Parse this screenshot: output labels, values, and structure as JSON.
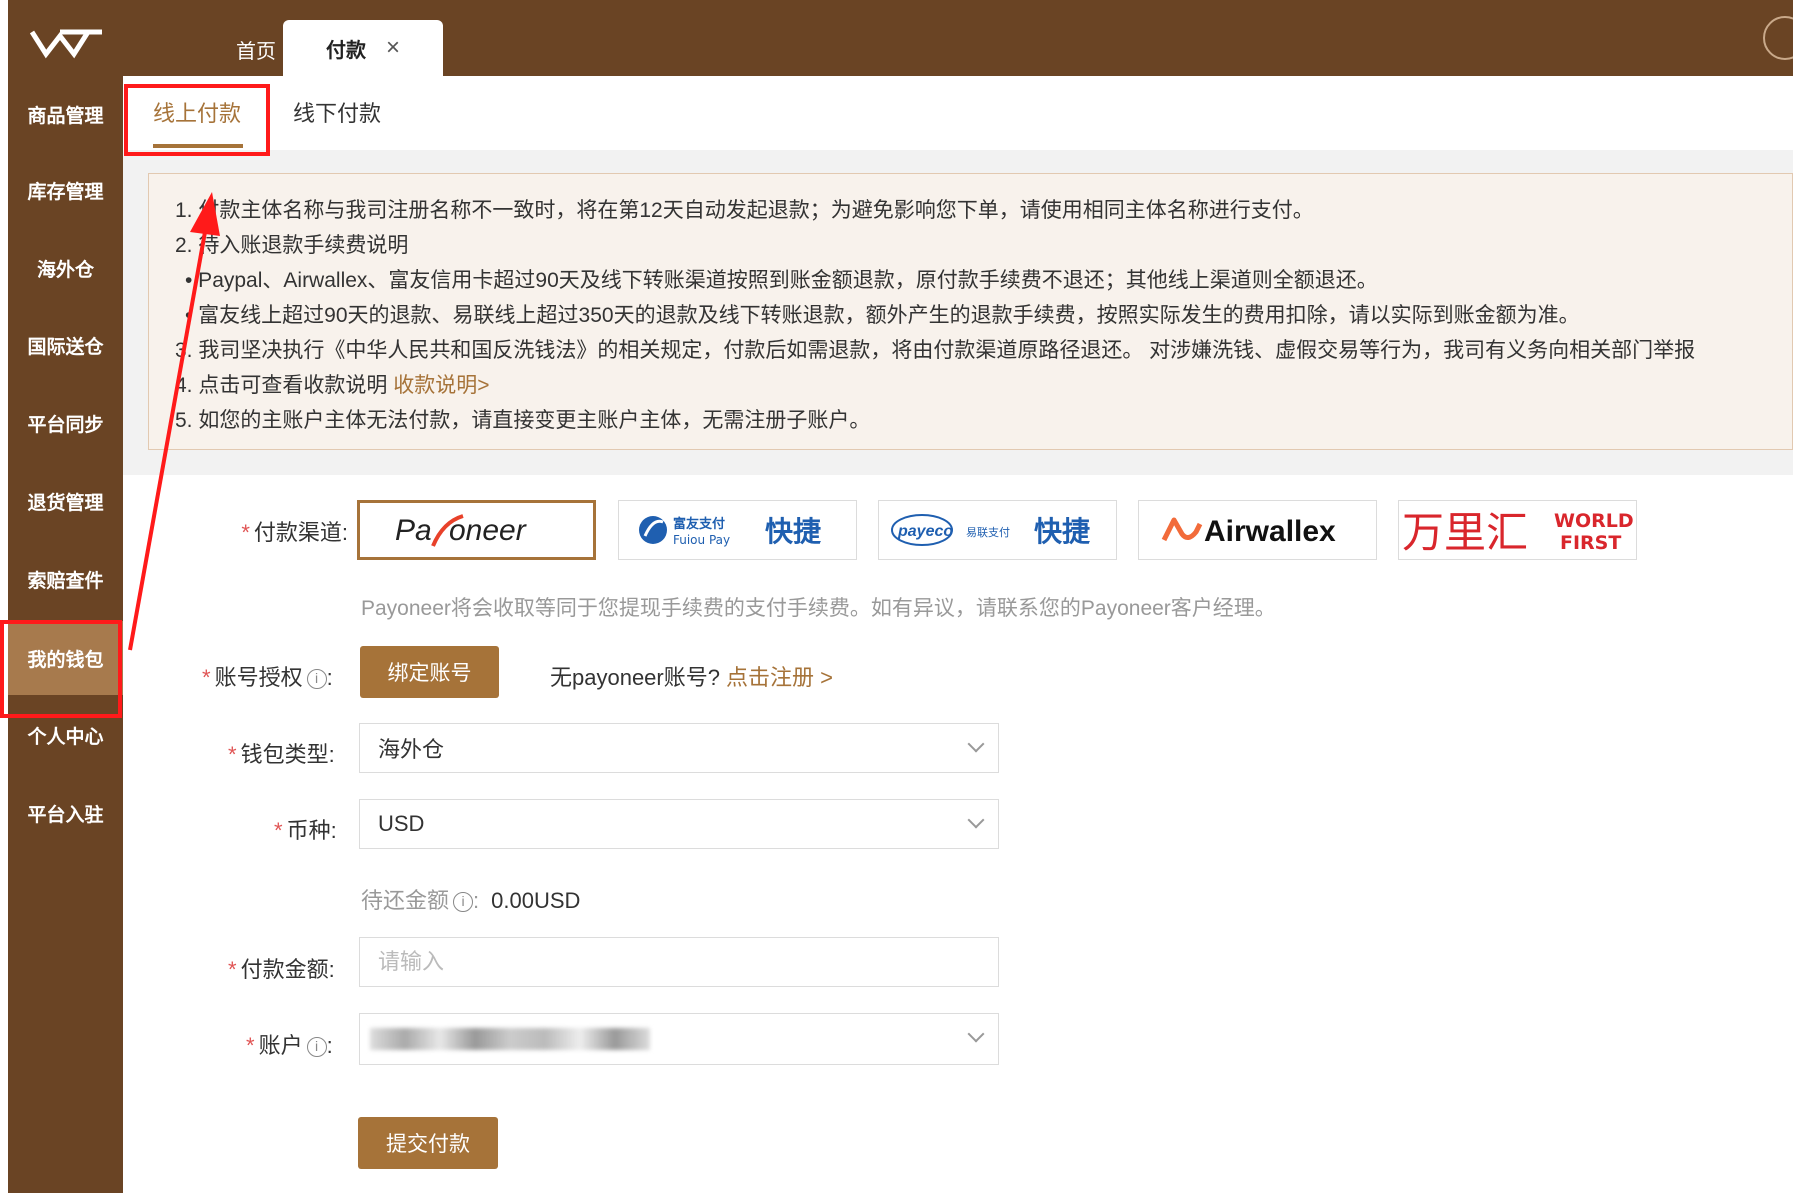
{
  "header": {
    "tab_home": "首页",
    "tab_pay": "付款",
    "tab_close": "×"
  },
  "sidebar": {
    "items": [
      {
        "label": "商品管理"
      },
      {
        "label": "库存管理"
      },
      {
        "label": "海外仓"
      },
      {
        "label": "国际送仓"
      },
      {
        "label": "平台同步"
      },
      {
        "label": "退货管理"
      },
      {
        "label": "索赔查件"
      },
      {
        "label": "我的钱包",
        "active": true
      },
      {
        "label": "个人中心"
      },
      {
        "label": "平台入驻"
      }
    ]
  },
  "subtabs": {
    "online": "线上付款",
    "offline": "线下付款"
  },
  "notice": {
    "lines": [
      "1. 付款主体名称与我司注册名称不一致时，将在第12天自动发起退款；为避免影响您下单，请使用相同主体名称进行支付。",
      "2. 待入账退款手续费说明",
      "• Paypal、Airwallex、富友信用卡超过90天及线下转账渠道按照到账金额退款，原付款手续费不退还；其他线上渠道则全额退还。",
      "• 富友线上超过90天的退款、易联线上超过350天的退款及线下转账退款，额外产生的退款手续费，按照实际发生的费用扣除，请以实际到账金额为准。",
      "3. 我司坚决执行《中华人民共和国反洗钱法》的相关规定，付款后如需退款，将由付款渠道原路径退还。 对涉嫌洗钱、虚假交易等行为，我司有义务向相关部门举报",
      "4. 点击可查看收款说明",
      "5. 如您的主账户主体无法付款，请直接变更主账户主体，无需注册子账户。"
    ],
    "link": "收款说明>"
  },
  "form": {
    "channel_label": "付款渠道:",
    "channels": [
      {
        "name": "Payoneer",
        "selected": true
      },
      {
        "name": "富友支付 Fuiou Pay 快捷"
      },
      {
        "name": "payeco 易联支付 快捷"
      },
      {
        "name": "Airwallex"
      },
      {
        "name": "万里汇 WORLD FIRST"
      }
    ],
    "channel_hint": "Payoneer将会收取等同于您提现手续费的支付手续费。如有异议，请联系您的Payoneer客户经理。",
    "auth_label": "账号授权",
    "bind_button": "绑定账号",
    "no_account_text": "无payoneer账号?",
    "register_link": "点击注册 >",
    "wallet_label": "钱包类型:",
    "wallet_value": "海外仓",
    "currency_label": "币种:",
    "currency_value": "USD",
    "pending_label": "待还金额",
    "pending_value": "0.00USD",
    "amount_label": "付款金额:",
    "amount_placeholder": "请输入",
    "account_label": "账户",
    "submit": "提交付款"
  },
  "colors": {
    "brand_dark": "#6a4424",
    "accent": "#a67339",
    "annotation": "#ff1a1a"
  }
}
